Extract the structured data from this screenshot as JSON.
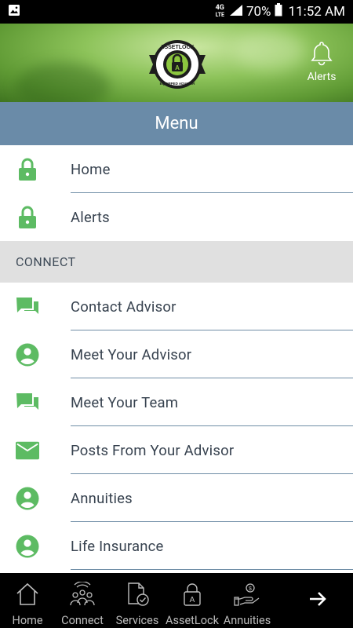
{
  "status_bar": {
    "network": "4G LTE",
    "battery": "70%",
    "time": "11:52 AM"
  },
  "header": {
    "logo_top_text": "ASSETLOCK",
    "logo_bottom_text": "EQUIPPED ADVISOR",
    "alerts_label": "Alerts"
  },
  "menu": {
    "title": "Menu",
    "items_top": [
      {
        "label": "Home",
        "icon": "lock-icon"
      },
      {
        "label": "Alerts",
        "icon": "lock-icon"
      }
    ],
    "section_connect": "CONNECT",
    "items_connect": [
      {
        "label": "Contact Advisor",
        "icon": "chat-icon"
      },
      {
        "label": "Meet Your Advisor",
        "icon": "person-icon"
      },
      {
        "label": "Meet Your Team",
        "icon": "chat-icon"
      },
      {
        "label": "Posts From Your Advisor",
        "icon": "mail-icon"
      },
      {
        "label": "Annuities",
        "icon": "person-icon"
      },
      {
        "label": "Life Insurance",
        "icon": "person-icon"
      }
    ]
  },
  "bottom_nav": {
    "items": [
      {
        "label": "Home",
        "icon": "home-icon"
      },
      {
        "label": "Connect",
        "icon": "people-icon"
      },
      {
        "label": "Services",
        "icon": "document-check-icon"
      },
      {
        "label": "AssetLock",
        "icon": "padlock-icon"
      },
      {
        "label": "Annuities",
        "icon": "hand-coin-icon"
      }
    ],
    "next_icon": "arrow-right-icon"
  },
  "colors": {
    "accent_green": "#5dbb63",
    "menu_bar": "#6a8ba8",
    "section_bg": "#e0e0e0",
    "text": "#37424f"
  }
}
